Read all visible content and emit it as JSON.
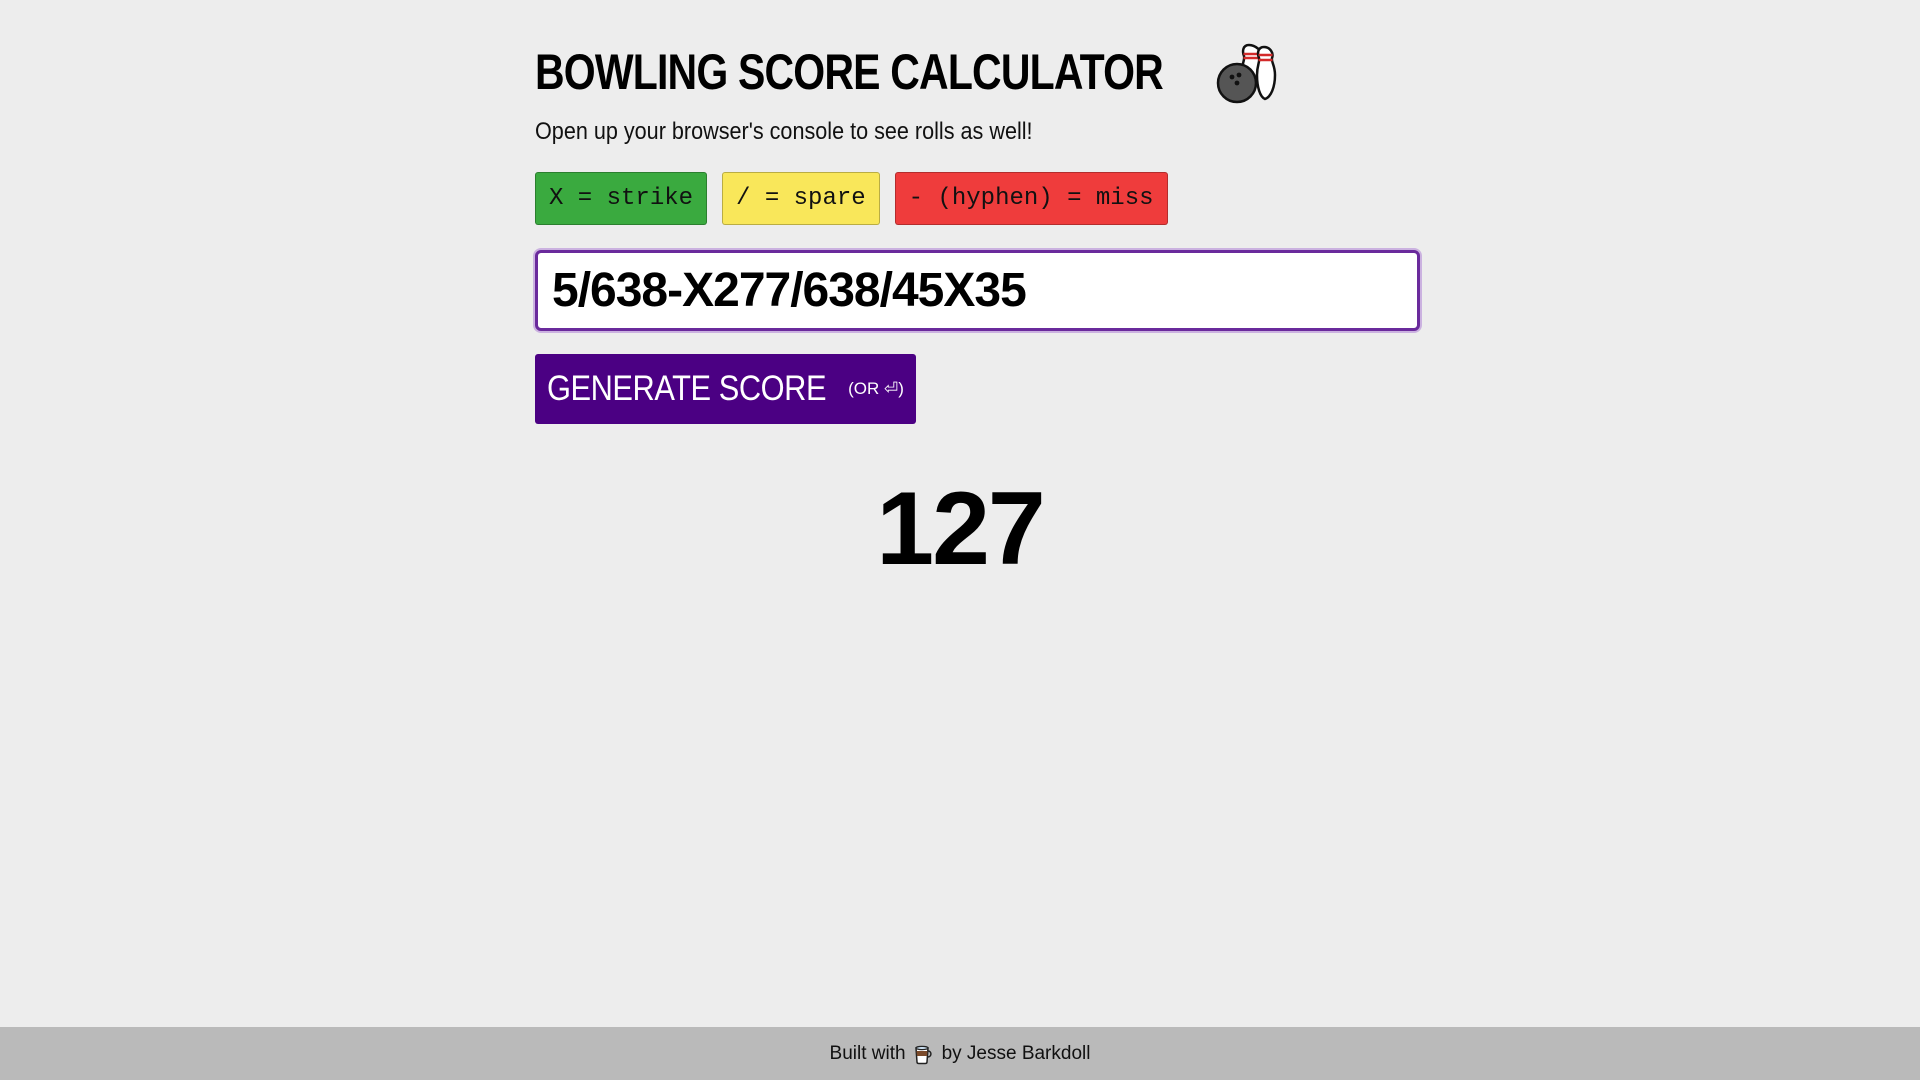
{
  "header": {
    "title": "BOWLING SCORE CALCULATOR",
    "title_icon": "bowling-icon",
    "subtitle": "Open up your browser's console to see rolls as well!"
  },
  "legend": {
    "strike": "X = strike",
    "spare": "/ = spare",
    "miss": "- (hyphen) = miss",
    "colors": {
      "strike": "#3aaa3f",
      "spare": "#f9e75a",
      "miss": "#ef3c3c"
    }
  },
  "input": {
    "value": "5/638-X277/638/45X35",
    "border_color": "#6a2a9c"
  },
  "button": {
    "label": "GENERATE SCORE",
    "hint": "(OR ⏎)",
    "color": "#4b0083"
  },
  "result": {
    "score": "127"
  },
  "footer": {
    "prefix": "Built with",
    "icon": "coffee-mug-icon",
    "suffix": "by Jesse Barkdoll"
  }
}
